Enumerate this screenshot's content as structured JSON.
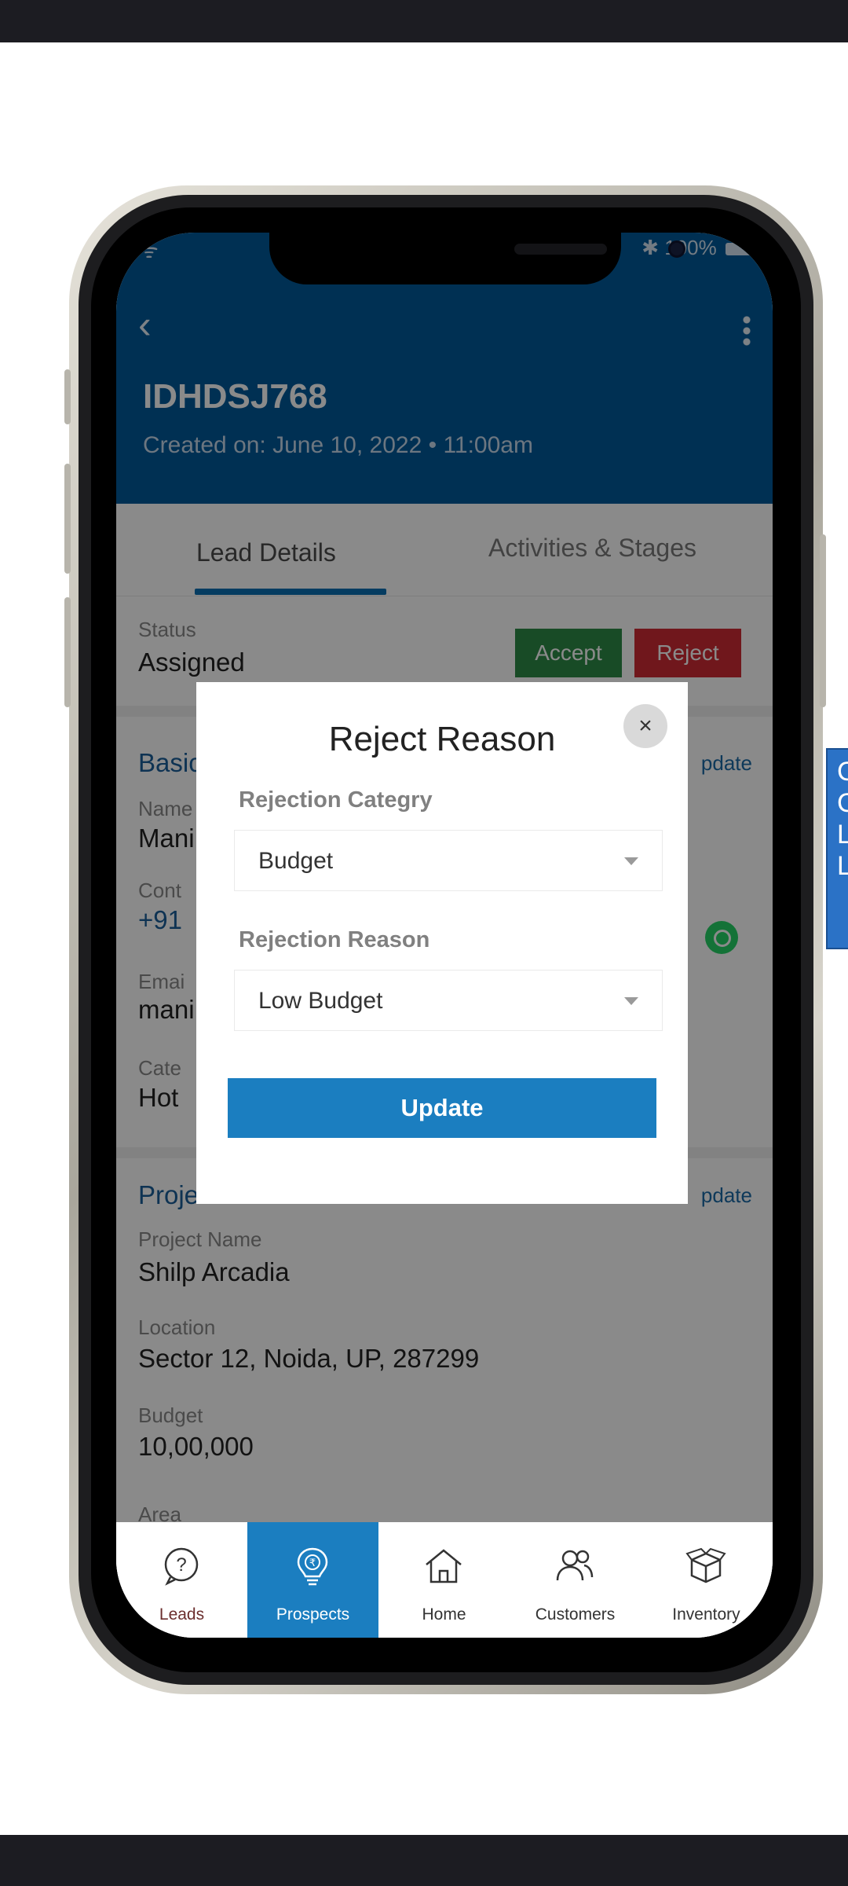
{
  "lead": {
    "id": "IDHDSJ768",
    "created": "Created on: June 10, 2022  •  11:00am"
  },
  "status_bar": {
    "battery": "100%",
    "bluetooth": "✱"
  },
  "tabs": [
    {
      "label": "Lead Details"
    },
    {
      "label": "Activities & Stages"
    }
  ],
  "status": {
    "label": "Status",
    "value": "Assigned",
    "accept": "Accept",
    "reject": "Reject"
  },
  "basic": {
    "title": "Basic",
    "update": "pdate",
    "name_label": "Name",
    "name_value": "Mani",
    "contact_label": "Cont",
    "contact_value": "+91",
    "email_label": "Emai",
    "email_value": "mani",
    "category_label": "Cate",
    "category_value": "Hot"
  },
  "project": {
    "title": "Proje",
    "update": "pdate",
    "name_label": "Project Name",
    "name_value": "Shilp Arcadia",
    "location_label": "Location",
    "location_value": "Sector 12, Noida, UP, 287299",
    "budget_label": "Budget",
    "budget_value": "10,00,000",
    "area_label": "Area"
  },
  "modal": {
    "title": "Reject Reason",
    "close": "×",
    "category_label": "Rejection Categry",
    "category_value": "Budget",
    "reason_label": "Rejection Reason",
    "reason_value": "Low Budget",
    "update": "Update"
  },
  "nav": [
    {
      "label": "Leads",
      "icon": "question-circle-icon",
      "active": false
    },
    {
      "label": "Prospects",
      "icon": "lightbulb-rupee-icon",
      "active": true
    },
    {
      "label": "Home",
      "icon": "home-icon",
      "active": false
    },
    {
      "label": "Customers",
      "icon": "users-icon",
      "active": false
    },
    {
      "label": "Inventory",
      "icon": "box-icon",
      "active": false
    }
  ],
  "callout": {
    "lines": [
      "C",
      "C",
      "L",
      "L"
    ]
  },
  "colors": {
    "header": "#005a99",
    "accent": "#1b7ec0",
    "accept": "#2e8b47",
    "reject": "#cf2b34"
  }
}
